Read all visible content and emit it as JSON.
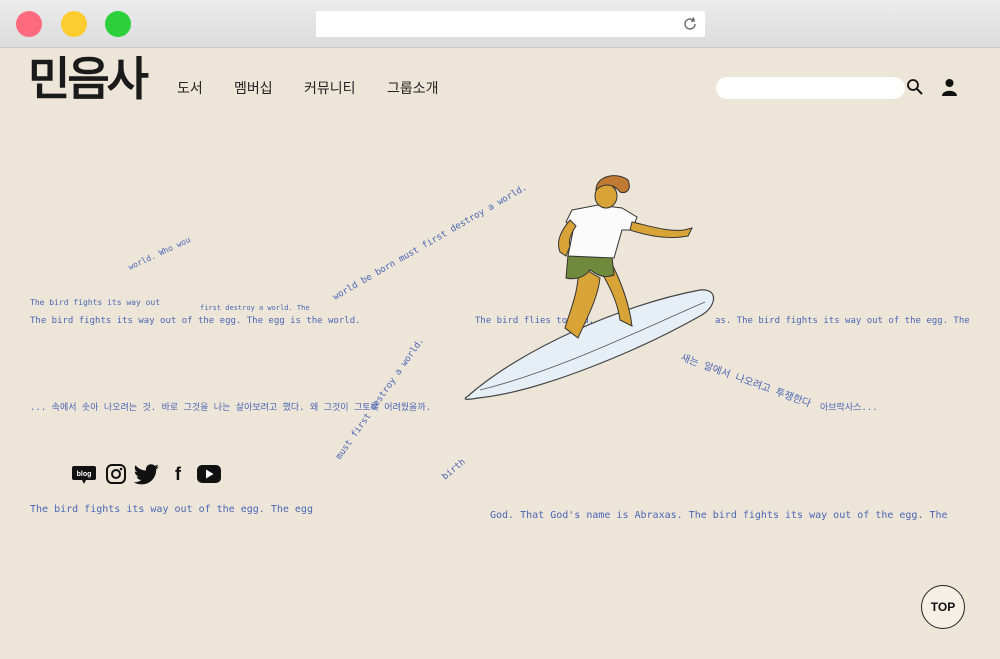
{
  "logo": {
    "text": "민음사"
  },
  "nav": {
    "items": [
      "도서",
      "멤버십",
      "커뮤니티",
      "그룹소개"
    ]
  },
  "search": {
    "placeholder": ""
  },
  "hero": {
    "line1_small": "The bird fights its way out",
    "line1": "The bird fights its way out of the egg. The egg is the world.",
    "line1_right": "The bird flies to God.",
    "line1_far": "as. The bird fights its way out of the egg. The",
    "wave1_a": "world. Who wou",
    "wave1_b": "first destroy a world. The",
    "wave2_a": "world be born must first destroy a world.",
    "line2": "... 속에서 솟아 나오려는 것. 바로 그것을 나는 살아보려고 했다. 왜 그것이 그토록 어려웠을까.",
    "line2_right": "아브락사스...",
    "wave3": "must first destroy a world.",
    "wave3_b": "birth",
    "line3": "The bird fights its way out of the egg. The egg",
    "line3_right": "God. That God's name is Abraxas. The bird fights its way out of the egg. The",
    "curl_kr": "새는 알에서 나오려고 투쟁한다"
  },
  "social": {
    "blog_label": "blog",
    "facebook_label": "f"
  },
  "top_button": {
    "label": "TOP"
  },
  "colors": {
    "background": "#ede5d8",
    "handwriting": "#4a66b5",
    "board": "#e6eff6"
  }
}
